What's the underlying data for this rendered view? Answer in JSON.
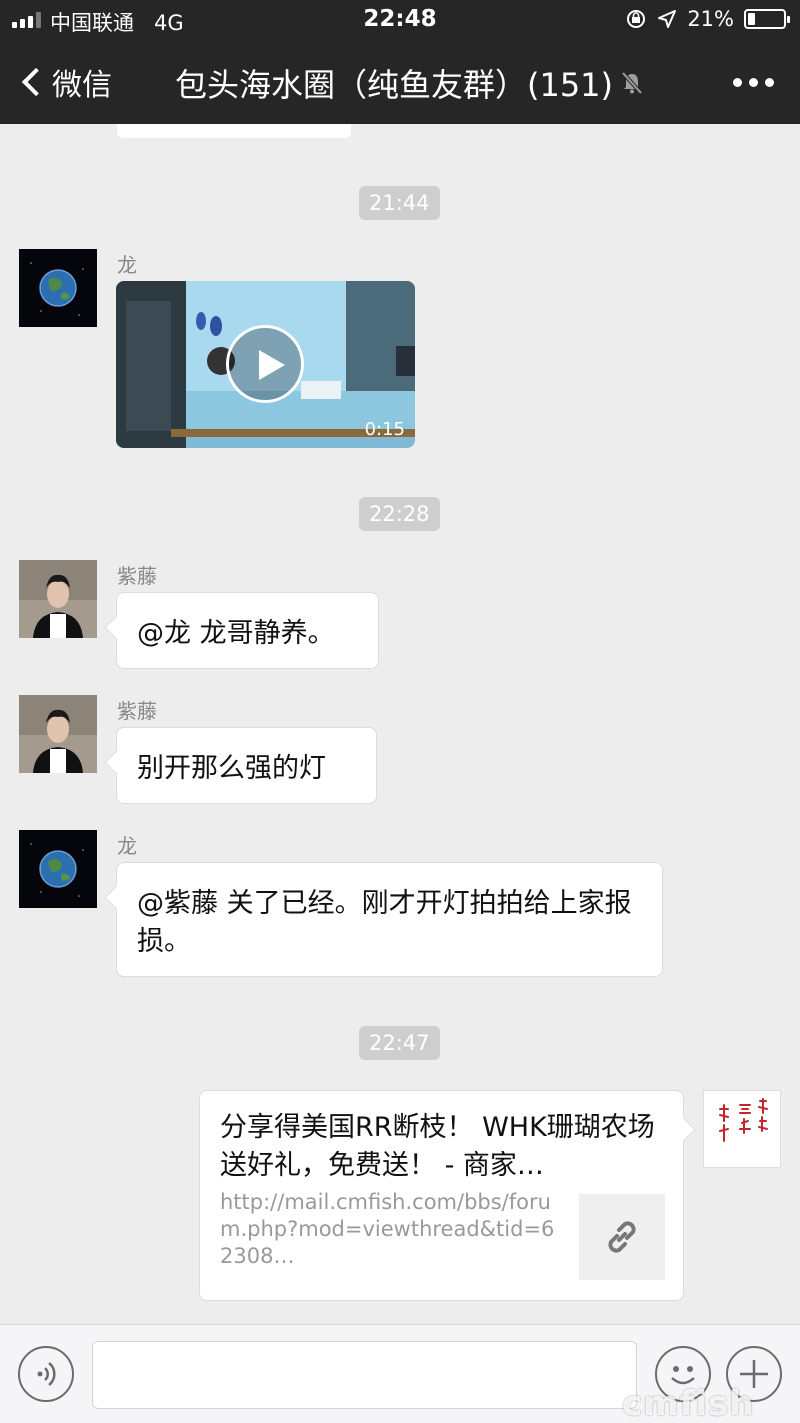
{
  "status_bar": {
    "carrier": "中国联通",
    "network": "4G",
    "time": "22:48",
    "battery": "21%",
    "battery_level": 0.21
  },
  "nav": {
    "back_label": "微信",
    "title": "包头海水圈（纯鱼友群）(151)"
  },
  "messages": [
    {
      "time": "21:44"
    },
    {
      "sender": "龙",
      "type": "video",
      "duration": "0:15"
    },
    {
      "time": "22:28"
    },
    {
      "sender": "紫藤",
      "type": "text",
      "text": "@龙 龙哥静养。"
    },
    {
      "sender": "紫藤",
      "type": "text",
      "text": "别开那么强的灯"
    },
    {
      "sender": "龙",
      "type": "text",
      "text": "@紫藤 关了已经。刚才开灯拍拍给上家报损。"
    },
    {
      "time": "22:47"
    },
    {
      "type": "link",
      "title": "分享得美国RR断枝！ WHK珊瑚农场送好礼，免费送！ - 商家…",
      "url": "http://mail.cmfish.com/bbs/forum.php?mod=viewthread&tid=62308…"
    }
  ],
  "watermark": "cmfish",
  "colors": {
    "header_bg": "#262626",
    "chat_bg": "#ededed",
    "time_badge_bg": "#cecece"
  }
}
